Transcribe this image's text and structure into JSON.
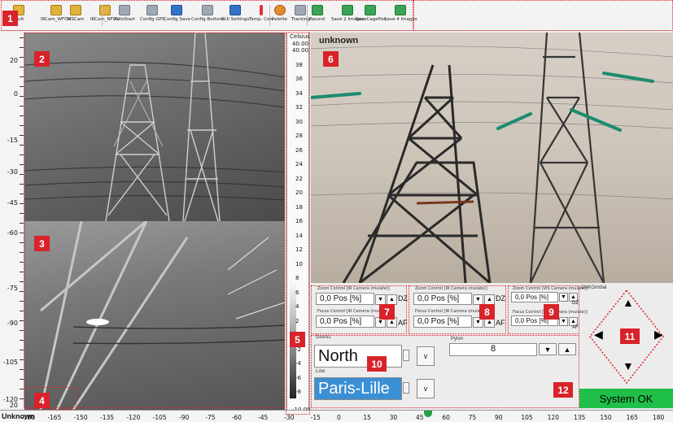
{
  "toolbar": {
    "buttons": [
      {
        "label": "fault",
        "icon": "yellow"
      },
      {
        "label": "IRCam_WFOV",
        "icon": "yellow"
      },
      {
        "label": "VISCam",
        "icon": "yellow"
      },
      {
        "label": "IRCam_NFOV",
        "icon": "yellow"
      },
      {
        "label": "AutoStart",
        "icon": "gray"
      },
      {
        "label": "Config GPS",
        "icon": "gray"
      },
      {
        "label": "Config Save",
        "icon": "blue"
      },
      {
        "label": "Config Buttons",
        "icon": "gray"
      },
      {
        "label": "GUI Settings",
        "icon": "blue"
      },
      {
        "label": "Temp. Con.",
        "icon": "therm"
      },
      {
        "label": "Palette",
        "icon": "orange"
      },
      {
        "label": "Tracking",
        "icon": "gray"
      },
      {
        "label": "Record",
        "icon": "green"
      },
      {
        "label": "Save 2 Images",
        "icon": "green"
      },
      {
        "label": "SaveCagePos",
        "icon": "green"
      },
      {
        "label": "Save 4 Images",
        "icon": "green"
      }
    ]
  },
  "left_ruler": {
    "labels": [
      "20",
      "0",
      "-15",
      "-30",
      "-45",
      "-60",
      "-75",
      "-90",
      "-105",
      "-120",
      "20"
    ]
  },
  "temp_scale": {
    "unit": "Celsius",
    "top_value": "40.00",
    "labels": [
      "40.00",
      "38",
      "36",
      "34",
      "32",
      "30",
      "28",
      "26",
      "24",
      "22",
      "20",
      "18",
      "16",
      "14",
      "12",
      "10",
      "8",
      "6",
      "4",
      "2",
      "0",
      "-2",
      "-4",
      "-6",
      "-8"
    ],
    "bottom_value": "-10.00"
  },
  "visual": {
    "title": "unknown"
  },
  "zoom_ir_wfov": {
    "zoom_label": "Zoom Control [IR Camera (mulate)]",
    "zoom_value": "0,0 Pos [%]",
    "dz": "DZ",
    "focus_label": "Focus Control [IR Camera (mulate)]",
    "focus_value": "0,0 Pos [%]",
    "af": "AF"
  },
  "zoom_ir_nfov": {
    "zoom_label": "Zoom Control [IR Camera (mulate)]",
    "zoom_value": "0,0 Pos [%]",
    "dz": "DZ",
    "focus_label": "Focus Control [IR Camera (mulate)]",
    "focus_value": "0,0 Pos [%]",
    "af": "AF"
  },
  "zoom_vis": {
    "zoom_label": "Zoom Control [VIS Camera (mulate)]",
    "zoom_value": "0,0 Pos [%]",
    "dz": "DZ",
    "focus_label": "Focus Control [VIS Camera (mulate)]",
    "focus_value": "0,0 Pos [%]",
    "af": "AF"
  },
  "nav": {
    "district_label": "District",
    "district_value": "North",
    "line_label": "Line",
    "line_value": "Paris-Lille",
    "v_button": "v",
    "pylon_label": "Pylon",
    "pylon_value": "8"
  },
  "gimbal": {
    "title": "SNKGimbal"
  },
  "status": {
    "text": "System OK",
    "color": "#1fbf4a"
  },
  "bottom_ruler": {
    "first": "Unknown",
    "labels": [
      "-180",
      "-165",
      "-150",
      "-135",
      "-120",
      "-105",
      "-90",
      "-75",
      "-60",
      "-45",
      "-30",
      "-15",
      "0",
      "15",
      "30",
      "45",
      "60",
      "75",
      "90",
      "105",
      "120",
      "135",
      "150",
      "165",
      "180"
    ]
  },
  "annotations": [
    "1",
    "2",
    "3",
    "4",
    "5",
    "6",
    "7",
    "8",
    "9",
    "10",
    "11",
    "12"
  ]
}
